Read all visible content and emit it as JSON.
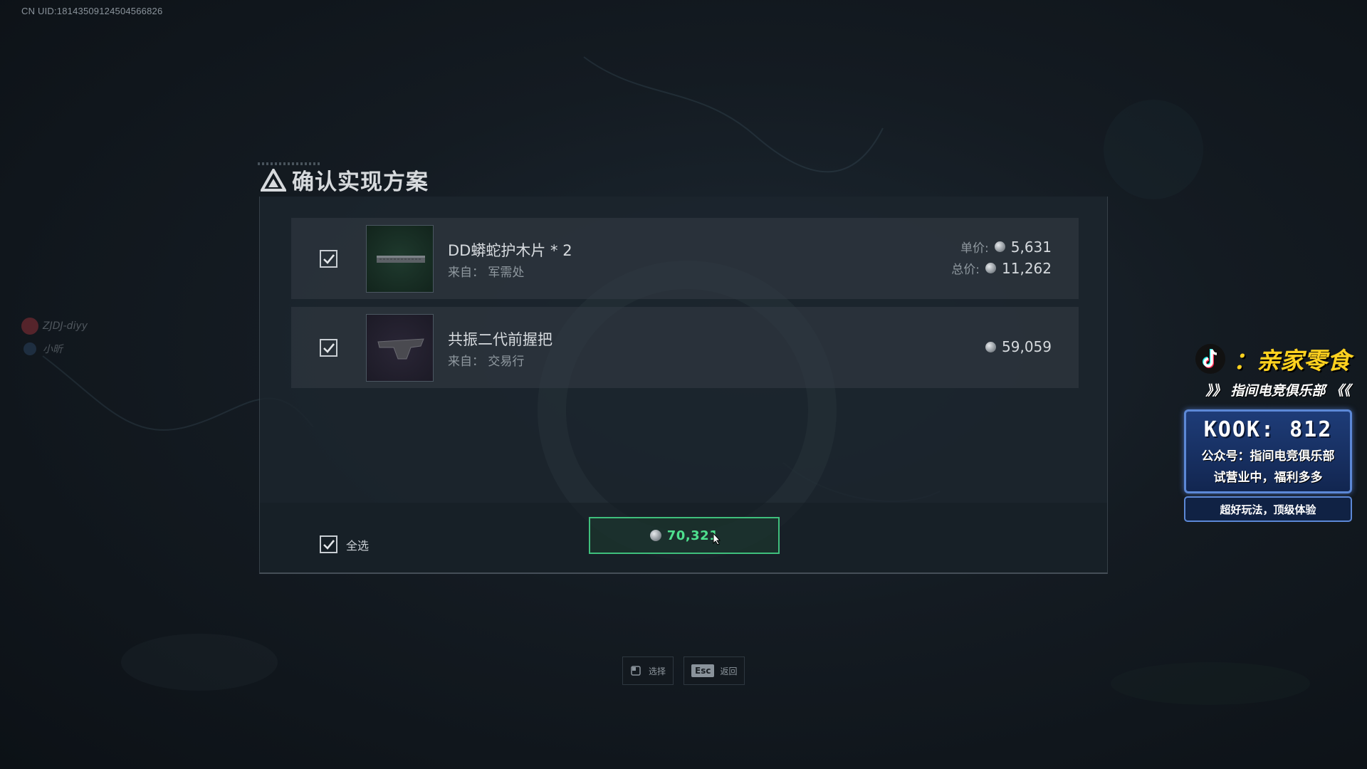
{
  "uid": "CN UID:18143509124504566826",
  "players": [
    {
      "name": "ZJDJ-diyy"
    },
    {
      "name": "小昕"
    }
  ],
  "dialog": {
    "title": "确认实现方案",
    "items": [
      {
        "name": "DD蟒蛇护木片 * 2",
        "source": "来自：  军需处",
        "unit_price_label": "单价:",
        "unit_price": "5,631",
        "total_price_label": "总价:",
        "total_price": "11,262",
        "checked": true
      },
      {
        "name": "共振二代前握把",
        "source": "来自：  交易行",
        "price": "59,059",
        "checked": true
      }
    ],
    "select_all_label": "全选",
    "total": "70,321"
  },
  "hints": [
    {
      "label": "选择",
      "icon": "mouse-icon"
    },
    {
      "key": "Esc",
      "label": "返回"
    }
  ],
  "promo": {
    "brand": "：亲家零食",
    "subtitle": "》》 指间电竞俱乐部 《《",
    "kook": "KOOK: 812",
    "line1": "公众号：指间电竞俱乐部",
    "line2": "试营业中，福利多多",
    "bottom": "超好玩法，顶级体验"
  },
  "colors": {
    "accent_green": "#4ee08e",
    "promo_yellow": "#ffd21f",
    "promo_blue": "#5c88d6"
  }
}
